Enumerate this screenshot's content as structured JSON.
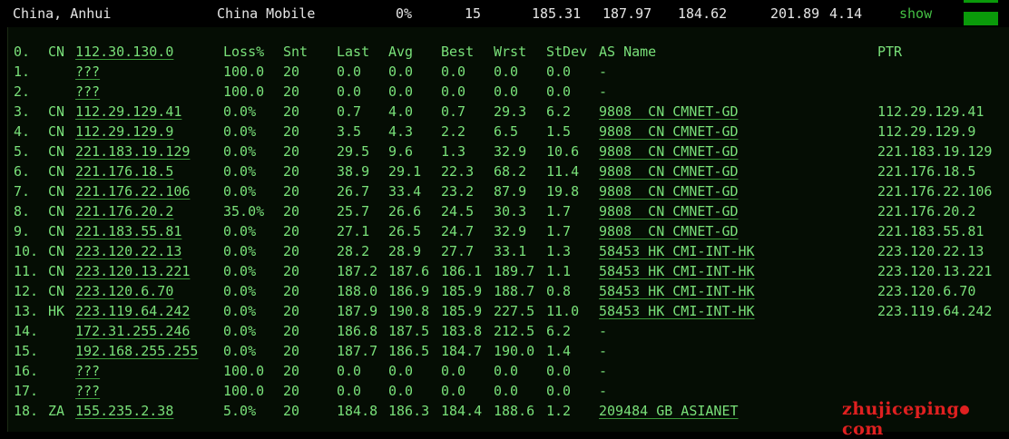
{
  "summary": {
    "location": "China, Anhui",
    "isp": "China Mobile",
    "loss": "0%",
    "sent": "15",
    "last": "185.31",
    "avg": "187.97",
    "best": "184.62",
    "worst": "201.89",
    "stdev": "4.14",
    "show_label": "show"
  },
  "columns": {
    "idx": "0.",
    "cc": "CN",
    "host": "112.30.130.0",
    "loss": "Loss%",
    "snt": "Snt",
    "last": "Last",
    "avg": "Avg",
    "best": "Best",
    "wrst": "Wrst",
    "stdev": "StDev",
    "as": "AS Name",
    "ptr": "PTR"
  },
  "hops": [
    {
      "idx": "1.",
      "cc": "",
      "host": "???",
      "loss": "100.0",
      "snt": "20",
      "last": "0.0",
      "avg": "0.0",
      "best": "0.0",
      "wrst": "0.0",
      "stdev": "0.0",
      "as": "-",
      "ptr": ""
    },
    {
      "idx": "2.",
      "cc": "",
      "host": "???",
      "loss": "100.0",
      "snt": "20",
      "last": "0.0",
      "avg": "0.0",
      "best": "0.0",
      "wrst": "0.0",
      "stdev": "0.0",
      "as": "-",
      "ptr": ""
    },
    {
      "idx": "3.",
      "cc": "CN",
      "host": "112.29.129.41",
      "loss": "0.0%",
      "snt": "20",
      "last": "0.7",
      "avg": "4.0",
      "best": "0.7",
      "wrst": "29.3",
      "stdev": "6.2",
      "as": "9808  CN CMNET-GD",
      "ptr": "112.29.129.41"
    },
    {
      "idx": "4.",
      "cc": "CN",
      "host": "112.29.129.9",
      "loss": "0.0%",
      "snt": "20",
      "last": "3.5",
      "avg": "4.3",
      "best": "2.2",
      "wrst": "6.5",
      "stdev": "1.5",
      "as": "9808  CN CMNET-GD",
      "ptr": "112.29.129.9"
    },
    {
      "idx": "5.",
      "cc": "CN",
      "host": "221.183.19.129",
      "loss": "0.0%",
      "snt": "20",
      "last": "29.5",
      "avg": "9.6",
      "best": "1.3",
      "wrst": "32.9",
      "stdev": "10.6",
      "as": "9808  CN CMNET-GD",
      "ptr": "221.183.19.129"
    },
    {
      "idx": "6.",
      "cc": "CN",
      "host": "221.176.18.5",
      "loss": "0.0%",
      "snt": "20",
      "last": "38.9",
      "avg": "29.1",
      "best": "22.3",
      "wrst": "68.2",
      "stdev": "11.4",
      "as": "9808  CN CMNET-GD",
      "ptr": "221.176.18.5"
    },
    {
      "idx": "7.",
      "cc": "CN",
      "host": "221.176.22.106",
      "loss": "0.0%",
      "snt": "20",
      "last": "26.7",
      "avg": "33.4",
      "best": "23.2",
      "wrst": "87.9",
      "stdev": "19.8",
      "as": "9808  CN CMNET-GD",
      "ptr": "221.176.22.106"
    },
    {
      "idx": "8.",
      "cc": "CN",
      "host": "221.176.20.2",
      "loss": "35.0%",
      "snt": "20",
      "last": "25.7",
      "avg": "26.6",
      "best": "24.5",
      "wrst": "30.3",
      "stdev": "1.7",
      "as": "9808  CN CMNET-GD",
      "ptr": "221.176.20.2"
    },
    {
      "idx": "9.",
      "cc": "CN",
      "host": "221.183.55.81",
      "loss": "0.0%",
      "snt": "20",
      "last": "27.1",
      "avg": "26.5",
      "best": "24.7",
      "wrst": "32.9",
      "stdev": "1.7",
      "as": "9808  CN CMNET-GD",
      "ptr": "221.183.55.81"
    },
    {
      "idx": "10.",
      "cc": "CN",
      "host": "223.120.22.13",
      "loss": "0.0%",
      "snt": "20",
      "last": "28.2",
      "avg": "28.9",
      "best": "27.7",
      "wrst": "33.1",
      "stdev": "1.3",
      "as": "58453 HK CMI-INT-HK",
      "ptr": "223.120.22.13"
    },
    {
      "idx": "11.",
      "cc": "CN",
      "host": "223.120.13.221",
      "loss": "0.0%",
      "snt": "20",
      "last": "187.2",
      "avg": "187.6",
      "best": "186.1",
      "wrst": "189.7",
      "stdev": "1.1",
      "as": "58453 HK CMI-INT-HK",
      "ptr": "223.120.13.221"
    },
    {
      "idx": "12.",
      "cc": "CN",
      "host": "223.120.6.70",
      "loss": "0.0%",
      "snt": "20",
      "last": "188.0",
      "avg": "186.9",
      "best": "185.9",
      "wrst": "188.7",
      "stdev": "0.8",
      "as": "58453 HK CMI-INT-HK",
      "ptr": "223.120.6.70"
    },
    {
      "idx": "13.",
      "cc": "HK",
      "host": "223.119.64.242",
      "loss": "0.0%",
      "snt": "20",
      "last": "187.9",
      "avg": "190.8",
      "best": "185.9",
      "wrst": "227.5",
      "stdev": "11.0",
      "as": "58453 HK CMI-INT-HK",
      "ptr": "223.119.64.242"
    },
    {
      "idx": "14.",
      "cc": "",
      "host": "172.31.255.246",
      "loss": "0.0%",
      "snt": "20",
      "last": "186.8",
      "avg": "187.5",
      "best": "183.8",
      "wrst": "212.5",
      "stdev": "6.2",
      "as": "-",
      "ptr": ""
    },
    {
      "idx": "15.",
      "cc": "",
      "host": "192.168.255.255",
      "loss": "0.0%",
      "snt": "20",
      "last": "187.7",
      "avg": "186.5",
      "best": "184.7",
      "wrst": "190.0",
      "stdev": "1.4",
      "as": "-",
      "ptr": ""
    },
    {
      "idx": "16.",
      "cc": "",
      "host": "???",
      "loss": "100.0",
      "snt": "20",
      "last": "0.0",
      "avg": "0.0",
      "best": "0.0",
      "wrst": "0.0",
      "stdev": "0.0",
      "as": "-",
      "ptr": ""
    },
    {
      "idx": "17.",
      "cc": "",
      "host": "???",
      "loss": "100.0",
      "snt": "20",
      "last": "0.0",
      "avg": "0.0",
      "best": "0.0",
      "wrst": "0.0",
      "stdev": "0.0",
      "as": "-",
      "ptr": ""
    },
    {
      "idx": "18.",
      "cc": "ZA",
      "host": "155.235.2.38",
      "loss": "5.0%",
      "snt": "20",
      "last": "184.8",
      "avg": "186.3",
      "best": "184.4",
      "wrst": "188.6",
      "stdev": "1.2",
      "as": "209484 GB ASIANET",
      "ptr": ""
    }
  ],
  "watermark": {
    "text_a": "zhujiceping",
    "text_b": "com"
  },
  "colors": {
    "text_green": "#79e079",
    "show_link": "#44c044",
    "bar_green": "#0a9a0a",
    "watermark_red": "#e02020"
  }
}
